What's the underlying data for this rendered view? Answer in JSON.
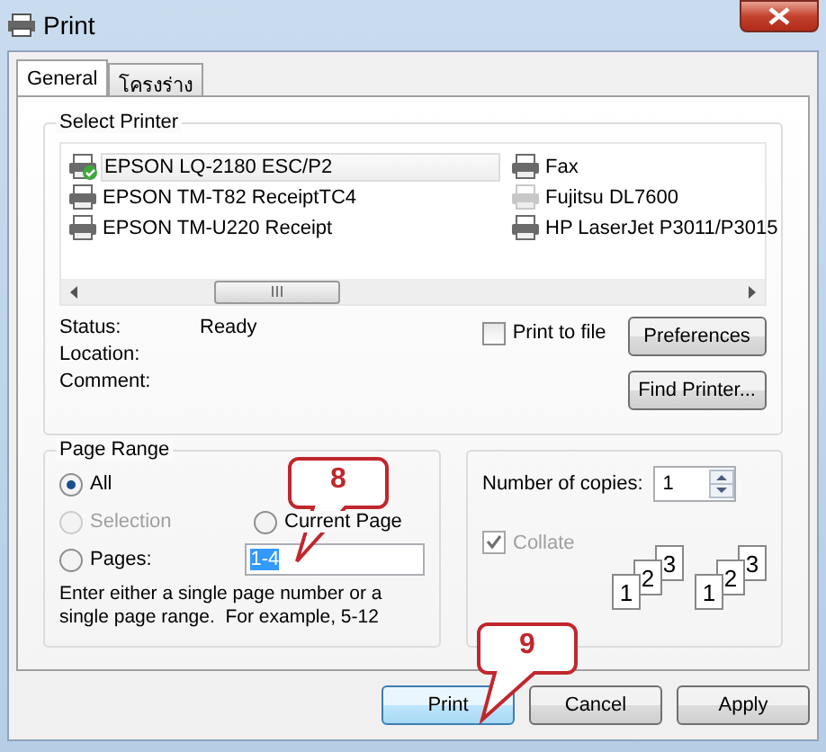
{
  "window": {
    "title": "Print"
  },
  "tabs": [
    {
      "label": "General",
      "selected": true
    },
    {
      "label": "โครงร่าง",
      "selected": false
    }
  ],
  "select_printer": {
    "title": "Select Printer",
    "printers": [
      {
        "name": "EPSON LQ-2180 ESC/P2",
        "selected": true,
        "default": true,
        "offline": false
      },
      {
        "name": "EPSON TM-T82 ReceiptTC4",
        "selected": false,
        "default": false,
        "offline": false
      },
      {
        "name": "EPSON TM-U220 Receipt",
        "selected": false,
        "default": false,
        "offline": false
      },
      {
        "name": "Fax",
        "selected": false,
        "default": false,
        "offline": false
      },
      {
        "name": "Fujitsu DL7600",
        "selected": false,
        "default": false,
        "offline": true
      },
      {
        "name": "HP LaserJet P3011/P3015",
        "selected": false,
        "default": false,
        "offline": false
      }
    ],
    "info": [
      {
        "label": "Status:",
        "value": "Ready"
      },
      {
        "label": "Location:"
      },
      {
        "label": "Comment:"
      }
    ],
    "print_to_file": {
      "label": "Print to file",
      "checked": false
    },
    "buttons": [
      "Preferences",
      "Find Printer..."
    ]
  },
  "page_range": {
    "title": "Page Range",
    "options": [
      {
        "label": "All",
        "selected": true,
        "disabled": false
      },
      {
        "label": "Selection",
        "selected": false,
        "disabled": true
      },
      {
        "label": "Current Page",
        "selected": false,
        "disabled": false
      },
      {
        "label": "Pages:",
        "selected": false,
        "disabled": false,
        "value": "1-4"
      }
    ],
    "hint": "Enter either a single page number or a single page range.  For example, 5-12"
  },
  "copies": {
    "label": "Number of copies:",
    "value": "1",
    "collate": {
      "label": "Collate",
      "checked": true,
      "disabled": true
    },
    "collate_sets": [
      [
        "1",
        "2",
        "3"
      ],
      [
        "1",
        "2",
        "3"
      ]
    ]
  },
  "buttons": [
    {
      "label": "Print",
      "default": true
    },
    {
      "label": "Cancel",
      "default": false
    },
    {
      "label": "Apply",
      "default": false
    }
  ],
  "callouts": [
    "8",
    "9"
  ]
}
